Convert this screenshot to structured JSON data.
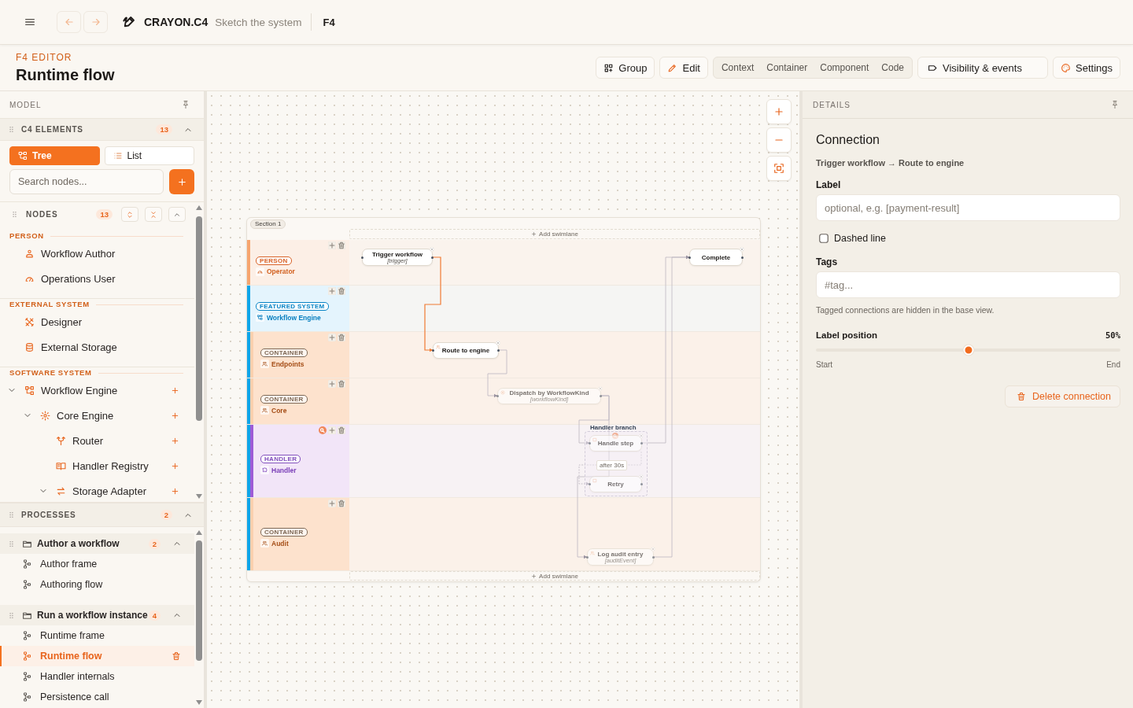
{
  "topbar": {
    "nav": {
      "back_disabled": true,
      "forward_disabled": true
    },
    "brand": "CRAYON.C4",
    "tagline": "Sketch the system",
    "project": "F4"
  },
  "header": {
    "eyebrow": "F4 EDITOR",
    "title": "Runtime flow"
  },
  "toolbar": {
    "group_button": "Group",
    "edit_button": "Edit",
    "levels": [
      {
        "label": "Context",
        "selected": false
      },
      {
        "label": "Container",
        "selected": false
      },
      {
        "label": "Component",
        "selected": false
      },
      {
        "label": "Code",
        "selected": false
      }
    ],
    "visibility_button": "Visibility & events",
    "settings_button": "Settings"
  },
  "sidebar": {
    "title": "MODEL",
    "elements": {
      "title": "C4 ELEMENTS",
      "count": "13",
      "expanded": true,
      "views": [
        {
          "kind": "tree",
          "label": "Tree",
          "selected": true
        },
        {
          "kind": "list",
          "label": "List",
          "selected": false
        }
      ],
      "search": {
        "placeholder": "Search nodes..."
      }
    },
    "nodes": {
      "title": "NODES",
      "count": "13",
      "expanded": true,
      "groups": [
        {
          "title": "PERSON",
          "kind": "flat",
          "items": [
            {
              "kind": "person",
              "label": "Workflow Author"
            },
            {
              "kind": "operator",
              "label": "Operations User"
            }
          ]
        },
        {
          "title": "EXTERNAL SYSTEM",
          "kind": "flat",
          "items": [
            {
              "kind": "tools",
              "label": "Designer"
            },
            {
              "kind": "database",
              "label": "External Storage"
            }
          ]
        },
        {
          "title": "SOFTWARE SYSTEM",
          "kind": "tree",
          "items": [
            {
              "kind": "system",
              "label": "Workflow Engine",
              "expanded": true,
              "children": [
                {
                  "kind": "component",
                  "label": "Core Engine",
                  "expanded": true,
                  "children": [
                    {
                      "kind": "router",
                      "label": "Router"
                    },
                    {
                      "kind": "registry",
                      "label": "Handler Registry"
                    },
                    {
                      "kind": "adapter",
                      "label": "Storage Adapter",
                      "expanded": true
                    }
                  ]
                }
              ]
            }
          ]
        }
      ]
    },
    "processes": {
      "title": "PROCESSES",
      "count": "2",
      "expanded": true,
      "groups": [
        {
          "title": "Author a workflow",
          "count": "2",
          "expanded": true,
          "items": [
            {
              "label": "Author frame",
              "selected": false
            },
            {
              "label": "Authoring flow",
              "selected": false
            }
          ]
        },
        {
          "title": "Run a workflow instance",
          "count": "4",
          "expanded": true,
          "items": [
            {
              "label": "Runtime frame",
              "selected": false
            },
            {
              "label": "Runtime flow",
              "selected": true
            },
            {
              "label": "Handler internals",
              "selected": false
            },
            {
              "label": "Persistence call",
              "selected": false
            }
          ]
        }
      ]
    }
  },
  "canvas": {
    "frame": {
      "section": "Section 1",
      "add_top": "Add swimlane",
      "add_bottom": "Add swimlane",
      "lanes": [
        {
          "kind": "person",
          "tag": "PERSON",
          "name": "Operator",
          "has_note": false
        },
        {
          "kind": "system",
          "tag": "FEATURED SYSTEM",
          "name": "Workflow Engine",
          "has_note": false,
          "children": [
            {
              "kind": "container",
              "tag": "CONTAINER",
              "name": "Endpoints",
              "has_note": false
            },
            {
              "kind": "container",
              "tag": "CONTAINER",
              "name": "Core",
              "has_note": false
            },
            {
              "kind": "handler",
              "tag": "HANDLER",
              "name": "Handler",
              "has_note": true
            },
            {
              "kind": "container",
              "tag": "CONTAINER",
              "name": "Audit",
              "has_note": false
            }
          ]
        }
      ]
    },
    "nodes": [
      {
        "kind": "event",
        "label": "Trigger workflow",
        "sublabel": "[trigger]",
        "faded": false
      },
      {
        "kind": "event",
        "label": "Complete",
        "faded": false
      },
      {
        "kind": "container",
        "label": "Route to engine",
        "faded": false
      },
      {
        "kind": "component",
        "label": "Dispatch by WorkflowKind",
        "sublabel": "[workflowKind]",
        "faded": true
      },
      {
        "kind": "handler",
        "label": "Handle step",
        "faded": true
      },
      {
        "kind": "handler",
        "label": "Retry",
        "faded": true
      },
      {
        "kind": "container",
        "label": "Log audit entry",
        "sublabel": "[auditEvent]",
        "faded": true
      }
    ],
    "groups": [
      {
        "label": "Handler branch",
        "has_note": true
      }
    ],
    "edges": [
      {
        "selected": true,
        "dashed": false
      },
      {
        "selected": false,
        "dashed": false
      },
      {
        "selected": false,
        "dashed": false
      },
      {
        "selected": false,
        "dashed": true,
        "label": "after 30s"
      },
      {
        "selected": false,
        "dashed": false
      },
      {
        "selected": false,
        "dashed": false
      },
      {
        "selected": false,
        "dashed": false
      }
    ]
  },
  "details": {
    "title": "DETAILS",
    "heading": "Connection",
    "route": "Trigger workflow → Route to engine",
    "label_field": {
      "label": "Label",
      "placeholder": "optional, e.g. [payment-result]"
    },
    "dashed": {
      "label": "Dashed line",
      "checked": false
    },
    "tags_field": {
      "label": "Tags",
      "placeholder": "#tag..."
    },
    "hint": "Tagged connections are hidden in the base view.",
    "position": {
      "label": "Label position",
      "reading": "50%",
      "level": 0.5,
      "start": "Start",
      "end": "End"
    },
    "delete_button": "Delete connection"
  }
}
